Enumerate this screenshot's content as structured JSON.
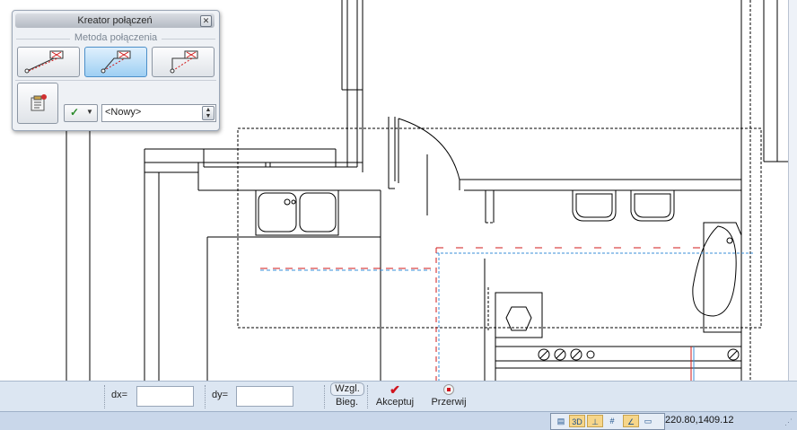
{
  "dialog": {
    "title": "Kreator połączeń",
    "group_label": "Metoda połączenia",
    "close_glyph": "✕",
    "methods": [
      {
        "icon": "direct-connection-icon",
        "selected": false
      },
      {
        "icon": "angled-connection-icon",
        "selected": true
      },
      {
        "icon": "orthogonal-connection-icon",
        "selected": false
      }
    ],
    "properties_icon": "properties-icon",
    "check_glyph": "✓",
    "combo_value": "<Nowy>"
  },
  "toolbar": {
    "dx_label": "dx=",
    "dx_value": "",
    "dy_label": "dy=",
    "dy_value": "",
    "wzgl_label": "Wzgl.",
    "bieg_label": "Bieg.",
    "accept_label": "Akceptuj",
    "accept_icon": "checkmark-icon",
    "cancel_label": "Przerwij",
    "cancel_icon": "stop-icon"
  },
  "status": {
    "icons": [
      "layers-icon",
      "3d-view-icon",
      "ortho-icon",
      "grid-icon",
      "snap-icon",
      "window-icon"
    ],
    "icon_3d_label": "3D",
    "coordinates": "220.80,1409.12"
  },
  "colors": {
    "accent_selected": "#9ecff3",
    "pipe_red": "#d01818",
    "pipe_blue": "#3a8fd8",
    "accept_red": "#d0141e"
  }
}
